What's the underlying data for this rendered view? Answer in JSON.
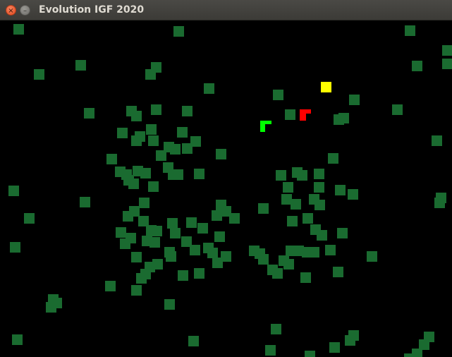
{
  "window": {
    "title": "Evolution IGF 2020",
    "close_glyph": "×",
    "minimize_glyph": "–"
  },
  "colors": {
    "background": "#000000",
    "food": "#1a6b30",
    "player_red": "#ff0000",
    "player_green": "#00ff00",
    "target_yellow": "#ffff00"
  },
  "icons": {
    "close": "close-icon",
    "minimize": "minimize-icon"
  },
  "game": {
    "food_count": 150,
    "creatures": [
      {
        "name": "red-creature",
        "color": "#ff0000",
        "shape": "L-block"
      },
      {
        "name": "green-creature",
        "color": "#00ff00",
        "shape": "L-block"
      }
    ],
    "target": {
      "name": "yellow-target",
      "color": "#ffff00"
    }
  }
}
